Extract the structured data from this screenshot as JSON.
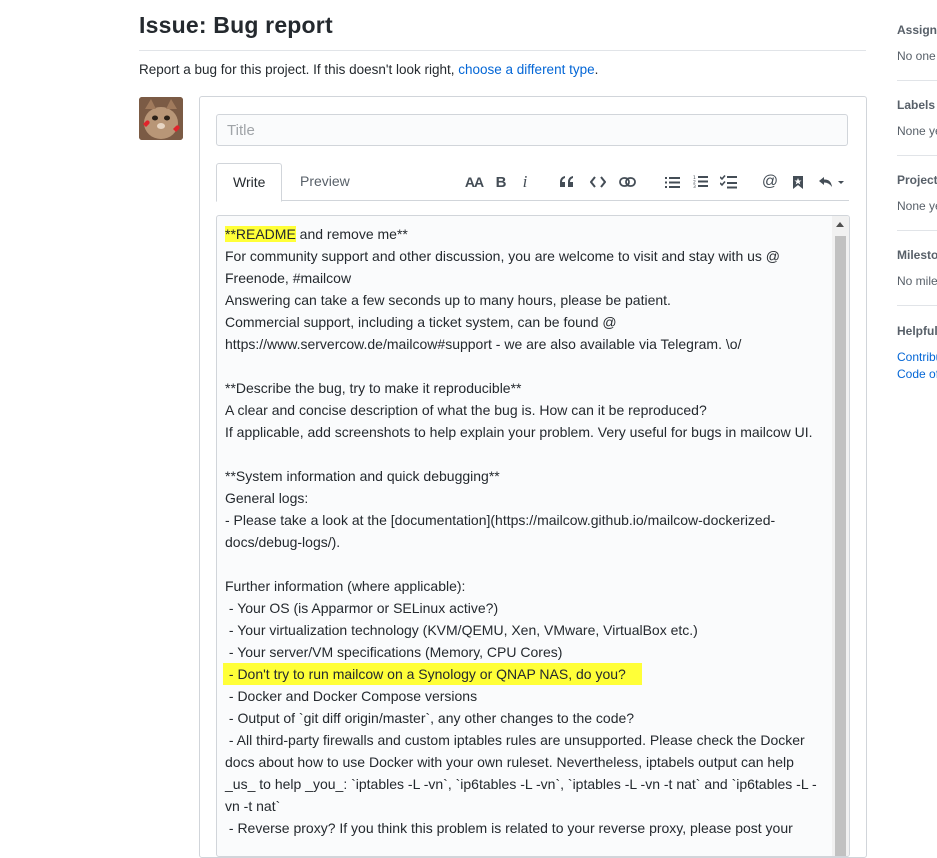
{
  "page": {
    "title": "Issue: Bug report",
    "intro_text": "Report a bug for this project. If this doesn't look right, ",
    "intro_link": "choose a different type",
    "intro_end": "."
  },
  "form": {
    "title_placeholder": "Title",
    "tabs": [
      {
        "label": "Write",
        "active": true
      },
      {
        "label": "Preview",
        "active": false
      }
    ],
    "toolbar": [
      "header-icon",
      "bold-icon",
      "italic-icon",
      "quote-icon",
      "code-icon",
      "link-icon",
      "bullet-list-icon",
      "numbered-list-icon",
      "task-list-icon",
      "mention-icon",
      "saved-reply-icon",
      "reply-icon"
    ],
    "toolbar_text": {
      "header": "AA",
      "bold": "B",
      "italic": "i",
      "mention": "@"
    }
  },
  "editor": {
    "highlight_color": "#ffff38",
    "line_1_highlight": "**README",
    "line_1_rest": " and remove me**",
    "block_1": "For community support and other discussion, you are welcome to visit and stay with us @ Freenode, #mailcow\nAnswering can take a few seconds up to many hours, please be patient.\nCommercial support, including a ticket system, can be found @ https://www.servercow.de/mailcow#support - we are also available via Telegram. \\o/\n\n**Describe the bug, try to make it reproducible**\nA clear and concise description of what the bug is. How can it be reproduced?\nIf applicable, add screenshots to help explain your problem. Very useful for bugs in mailcow UI.\n\n**System information and quick debugging**\nGeneral logs:\n- Please take a look at the [documentation](https://mailcow.github.io/mailcow-dockerized-docs/debug-logs/).\n\nFurther information (where applicable):\n - Your OS (is Apparmor or SELinux active?)\n - Your virtualization technology (KVM/QEMU, Xen, VMware, VirtualBox etc.)\n - Your server/VM specifications (Memory, CPU Cores)\n",
    "highlighted_line": " - Don't try to run mailcow on a Synology or QNAP NAS, do you?",
    "block_2": "\n - Docker and Docker Compose versions\n - Output of `git diff origin/master`, any other changes to the code?\n - All third-party firewalls and custom iptables rules are unsupported. Please check the Docker docs about how to use Docker with your own ruleset. Nevertheless, iptabels output can help _us_ to help _you_: `iptables -L -vn`, `ip6tables -L -vn`, `iptables -L -vn -t nat` and `ip6tables -L -vn -t nat`\n - Reverse proxy? If you think this problem is related to your reverse proxy, please post your"
  },
  "sidebar": [
    {
      "heading": "Assignees",
      "value": "No one"
    },
    {
      "heading": "Labels",
      "value": "None yet"
    },
    {
      "heading": "Projects",
      "value": "None yet"
    },
    {
      "heading": "Milestone",
      "value": "No milestone"
    },
    {
      "heading": "Helpful resources",
      "links": [
        "Contributing",
        "Code of conduct"
      ]
    }
  ],
  "colors": {
    "link": "#0366d6",
    "border": "#d1d5da",
    "muted": "#586069",
    "text": "#24292e"
  }
}
